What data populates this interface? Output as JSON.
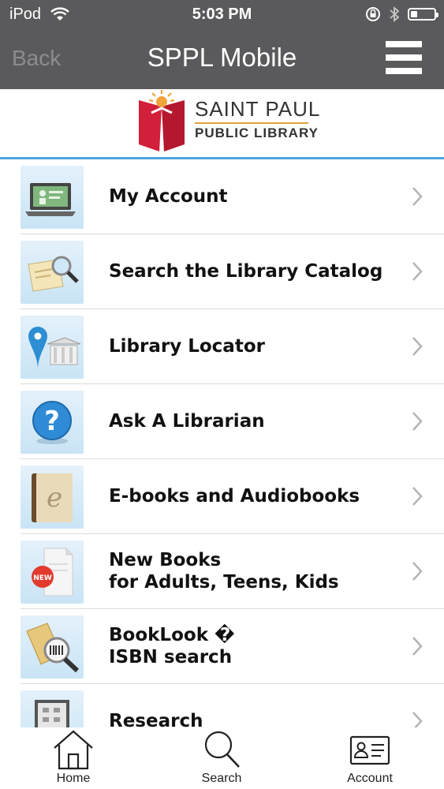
{
  "status_bar": {
    "carrier": "iPod",
    "time": "5:03 PM"
  },
  "nav": {
    "back_label": "Back",
    "title": "SPPL Mobile"
  },
  "logo": {
    "line1": "SAINT PAUL",
    "line2": "PUBLIC LIBRARY"
  },
  "menu": [
    {
      "line1": "My Account",
      "line2": "",
      "icon": "laptop-icon"
    },
    {
      "line1": "Search the Library Catalog",
      "line2": "",
      "icon": "catalog-search-icon"
    },
    {
      "line1": "Library Locator",
      "line2": "",
      "icon": "map-pin-library-icon"
    },
    {
      "line1": "Ask A Librarian",
      "line2": "",
      "icon": "question-icon"
    },
    {
      "line1": "E-books and Audiobooks",
      "line2": "",
      "icon": "ebook-icon"
    },
    {
      "line1": "New Books",
      "line2": "for Adults, Teens, Kids",
      "icon": "new-books-icon"
    },
    {
      "line1": "BookLook �",
      "line2": "ISBN search",
      "icon": "barcode-search-icon"
    },
    {
      "line1": "Research",
      "line2": "",
      "icon": "research-icon"
    }
  ],
  "tabs": {
    "home": "Home",
    "search": "Search",
    "account": "Account"
  }
}
